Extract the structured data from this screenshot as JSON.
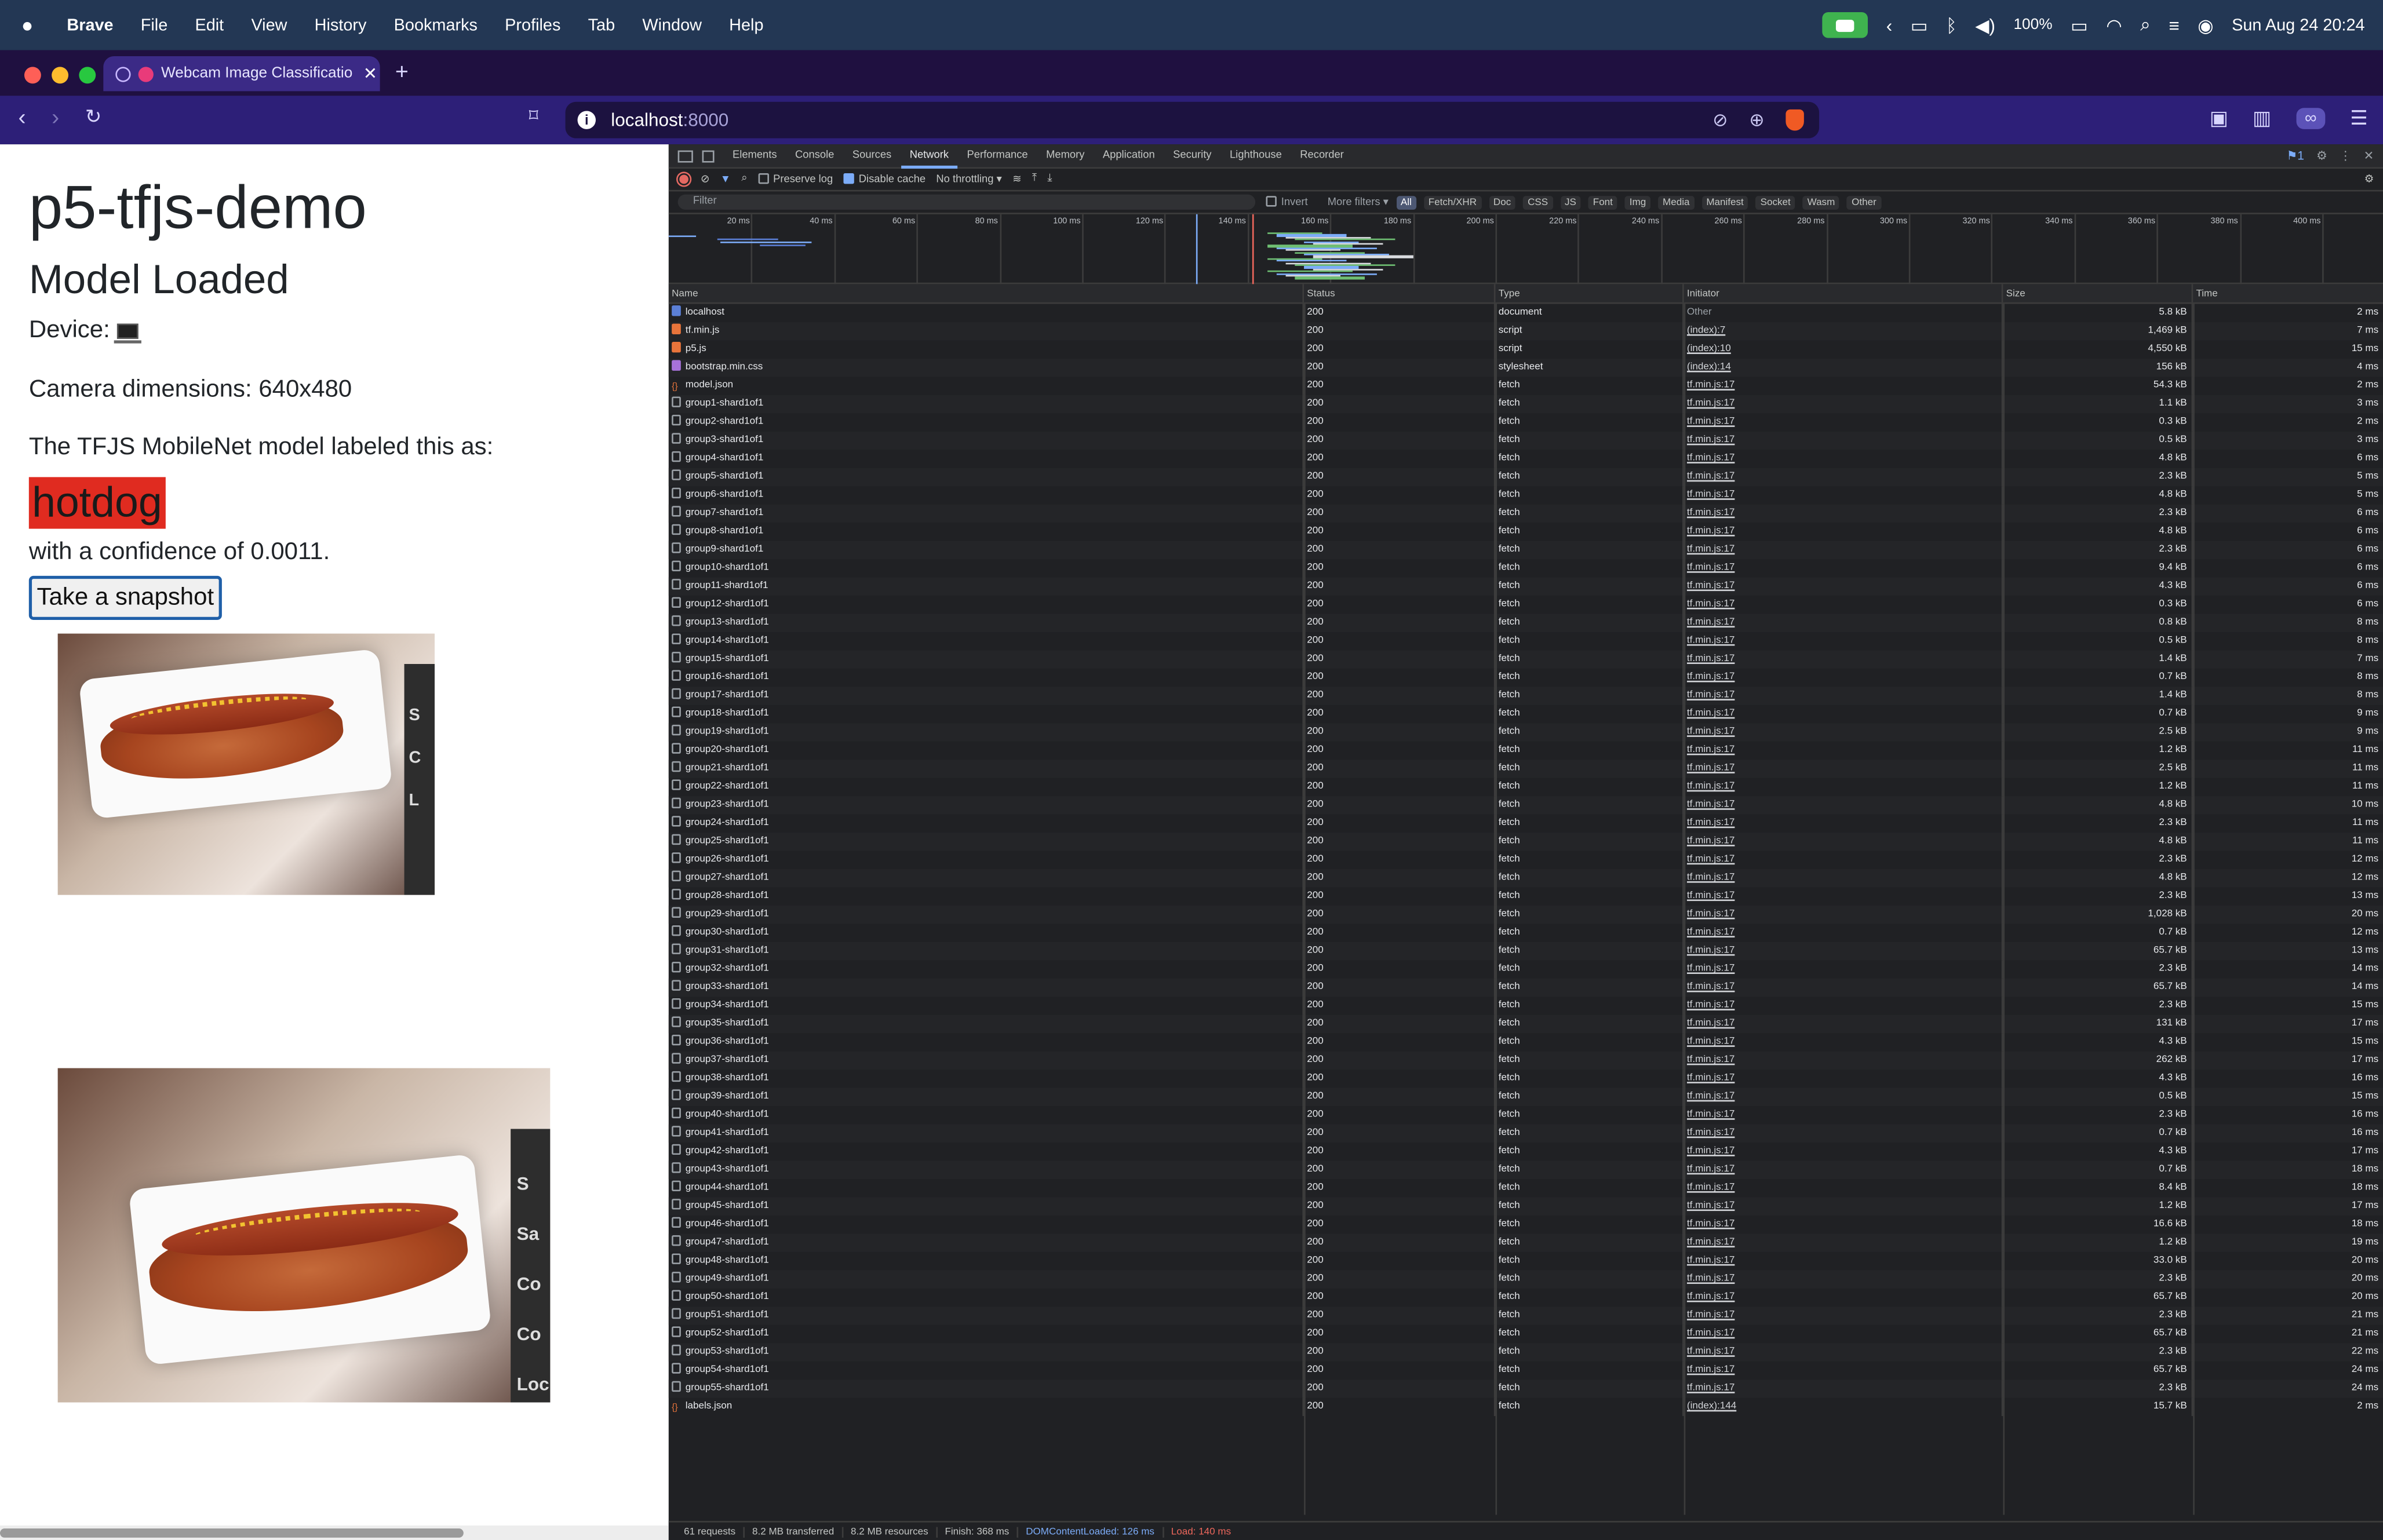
{
  "menubar": {
    "app": "Brave",
    "items": [
      "File",
      "Edit",
      "View",
      "History",
      "Bookmarks",
      "Profiles",
      "Tab",
      "Window",
      "Help"
    ],
    "battery": "100%",
    "datetime": "Sun Aug 24  20:24"
  },
  "browser": {
    "tab_title": "Webcam Image Classificatio",
    "url_host": "localhost",
    "url_port": ":8000"
  },
  "page": {
    "title": "p5-tfjs-demo",
    "status": "Model Loaded",
    "device_label": "Device:",
    "camera": "Camera dimensions: 640x480",
    "labeled_text": "The TFJS MobileNet model labeled this as:",
    "label": "hotdog",
    "confidence": "with a confidence of 0.0011.",
    "snapshot_button": "Take a snapshot",
    "frame1_side": [
      "S",
      "C",
      "L"
    ],
    "frame2_side": [
      "S",
      "Sa",
      "Co",
      "Co",
      "Loc"
    ]
  },
  "devtools": {
    "tabs": [
      "Elements",
      "Console",
      "Sources",
      "Network",
      "Performance",
      "Memory",
      "Application",
      "Security",
      "Lighthouse",
      "Recorder"
    ],
    "active_tab": "Network",
    "issues_badge": "1",
    "preserve_log": "Preserve log",
    "disable_cache": "Disable cache",
    "throttling": "No throttling",
    "filter_placeholder": "Filter",
    "invert": "Invert",
    "more_filters": "More filters",
    "type_filters": [
      "All",
      "Fetch/XHR",
      "Doc",
      "CSS",
      "JS",
      "Font",
      "Img",
      "Media",
      "Manifest",
      "Socket",
      "Wasm",
      "Other"
    ],
    "timeline_ticks": [
      "20 ms",
      "40 ms",
      "60 ms",
      "80 ms",
      "100 ms",
      "120 ms",
      "140 ms",
      "160 ms",
      "180 ms",
      "200 ms",
      "220 ms",
      "240 ms",
      "260 ms",
      "280 ms",
      "300 ms",
      "320 ms",
      "340 ms",
      "360 ms",
      "380 ms",
      "400 ms"
    ],
    "columns": [
      "Name",
      "Status",
      "Type",
      "Initiator",
      "Size",
      "Time"
    ],
    "requests": [
      {
        "name": "localhost",
        "status": "200",
        "type": "document",
        "initiator": "Other",
        "size": "5.8 kB",
        "time": "2 ms",
        "icon": "doc"
      },
      {
        "name": "tf.min.js",
        "status": "200",
        "type": "script",
        "initiator": "(index):7",
        "size": "1,469 kB",
        "time": "7 ms",
        "icon": "js"
      },
      {
        "name": "p5.js",
        "status": "200",
        "type": "script",
        "initiator": "(index):10",
        "size": "4,550 kB",
        "time": "15 ms",
        "icon": "js"
      },
      {
        "name": "bootstrap.min.css",
        "status": "200",
        "type": "stylesheet",
        "initiator": "(index):14",
        "size": "156 kB",
        "time": "4 ms",
        "icon": "css"
      },
      {
        "name": "model.json",
        "status": "200",
        "type": "fetch",
        "initiator": "tf.min.js:17",
        "size": "54.3 kB",
        "time": "2 ms",
        "icon": "json"
      },
      {
        "name": "group1-shard1of1",
        "status": "200",
        "type": "fetch",
        "initiator": "tf.min.js:17",
        "size": "1.1 kB",
        "time": "3 ms",
        "icon": "file"
      },
      {
        "name": "group2-shard1of1",
        "status": "200",
        "type": "fetch",
        "initiator": "tf.min.js:17",
        "size": "0.3 kB",
        "time": "2 ms",
        "icon": "file"
      },
      {
        "name": "group3-shard1of1",
        "status": "200",
        "type": "fetch",
        "initiator": "tf.min.js:17",
        "size": "0.5 kB",
        "time": "3 ms",
        "icon": "file"
      },
      {
        "name": "group4-shard1of1",
        "status": "200",
        "type": "fetch",
        "initiator": "tf.min.js:17",
        "size": "4.8 kB",
        "time": "6 ms",
        "icon": "file"
      },
      {
        "name": "group5-shard1of1",
        "status": "200",
        "type": "fetch",
        "initiator": "tf.min.js:17",
        "size": "2.3 kB",
        "time": "5 ms",
        "icon": "file"
      },
      {
        "name": "group6-shard1of1",
        "status": "200",
        "type": "fetch",
        "initiator": "tf.min.js:17",
        "size": "4.8 kB",
        "time": "5 ms",
        "icon": "file"
      },
      {
        "name": "group7-shard1of1",
        "status": "200",
        "type": "fetch",
        "initiator": "tf.min.js:17",
        "size": "2.3 kB",
        "time": "6 ms",
        "icon": "file"
      },
      {
        "name": "group8-shard1of1",
        "status": "200",
        "type": "fetch",
        "initiator": "tf.min.js:17",
        "size": "4.8 kB",
        "time": "6 ms",
        "icon": "file"
      },
      {
        "name": "group9-shard1of1",
        "status": "200",
        "type": "fetch",
        "initiator": "tf.min.js:17",
        "size": "2.3 kB",
        "time": "6 ms",
        "icon": "file"
      },
      {
        "name": "group10-shard1of1",
        "status": "200",
        "type": "fetch",
        "initiator": "tf.min.js:17",
        "size": "9.4 kB",
        "time": "6 ms",
        "icon": "file"
      },
      {
        "name": "group11-shard1of1",
        "status": "200",
        "type": "fetch",
        "initiator": "tf.min.js:17",
        "size": "4.3 kB",
        "time": "6 ms",
        "icon": "file"
      },
      {
        "name": "group12-shard1of1",
        "status": "200",
        "type": "fetch",
        "initiator": "tf.min.js:17",
        "size": "0.3 kB",
        "time": "6 ms",
        "icon": "file"
      },
      {
        "name": "group13-shard1of1",
        "status": "200",
        "type": "fetch",
        "initiator": "tf.min.js:17",
        "size": "0.8 kB",
        "time": "8 ms",
        "icon": "file"
      },
      {
        "name": "group14-shard1of1",
        "status": "200",
        "type": "fetch",
        "initiator": "tf.min.js:17",
        "size": "0.5 kB",
        "time": "8 ms",
        "icon": "file"
      },
      {
        "name": "group15-shard1of1",
        "status": "200",
        "type": "fetch",
        "initiator": "tf.min.js:17",
        "size": "1.4 kB",
        "time": "7 ms",
        "icon": "file"
      },
      {
        "name": "group16-shard1of1",
        "status": "200",
        "type": "fetch",
        "initiator": "tf.min.js:17",
        "size": "0.7 kB",
        "time": "8 ms",
        "icon": "file"
      },
      {
        "name": "group17-shard1of1",
        "status": "200",
        "type": "fetch",
        "initiator": "tf.min.js:17",
        "size": "1.4 kB",
        "time": "8 ms",
        "icon": "file"
      },
      {
        "name": "group18-shard1of1",
        "status": "200",
        "type": "fetch",
        "initiator": "tf.min.js:17",
        "size": "0.7 kB",
        "time": "9 ms",
        "icon": "file"
      },
      {
        "name": "group19-shard1of1",
        "status": "200",
        "type": "fetch",
        "initiator": "tf.min.js:17",
        "size": "2.5 kB",
        "time": "9 ms",
        "icon": "file"
      },
      {
        "name": "group20-shard1of1",
        "status": "200",
        "type": "fetch",
        "initiator": "tf.min.js:17",
        "size": "1.2 kB",
        "time": "11 ms",
        "icon": "file"
      },
      {
        "name": "group21-shard1of1",
        "status": "200",
        "type": "fetch",
        "initiator": "tf.min.js:17",
        "size": "2.5 kB",
        "time": "11 ms",
        "icon": "file"
      },
      {
        "name": "group22-shard1of1",
        "status": "200",
        "type": "fetch",
        "initiator": "tf.min.js:17",
        "size": "1.2 kB",
        "time": "11 ms",
        "icon": "file"
      },
      {
        "name": "group23-shard1of1",
        "status": "200",
        "type": "fetch",
        "initiator": "tf.min.js:17",
        "size": "4.8 kB",
        "time": "10 ms",
        "icon": "file"
      },
      {
        "name": "group24-shard1of1",
        "status": "200",
        "type": "fetch",
        "initiator": "tf.min.js:17",
        "size": "2.3 kB",
        "time": "11 ms",
        "icon": "file"
      },
      {
        "name": "group25-shard1of1",
        "status": "200",
        "type": "fetch",
        "initiator": "tf.min.js:17",
        "size": "4.8 kB",
        "time": "11 ms",
        "icon": "file"
      },
      {
        "name": "group26-shard1of1",
        "status": "200",
        "type": "fetch",
        "initiator": "tf.min.js:17",
        "size": "2.3 kB",
        "time": "12 ms",
        "icon": "file"
      },
      {
        "name": "group27-shard1of1",
        "status": "200",
        "type": "fetch",
        "initiator": "tf.min.js:17",
        "size": "4.8 kB",
        "time": "12 ms",
        "icon": "file"
      },
      {
        "name": "group28-shard1of1",
        "status": "200",
        "type": "fetch",
        "initiator": "tf.min.js:17",
        "size": "2.3 kB",
        "time": "13 ms",
        "icon": "file"
      },
      {
        "name": "group29-shard1of1",
        "status": "200",
        "type": "fetch",
        "initiator": "tf.min.js:17",
        "size": "1,028 kB",
        "time": "20 ms",
        "icon": "file"
      },
      {
        "name": "group30-shard1of1",
        "status": "200",
        "type": "fetch",
        "initiator": "tf.min.js:17",
        "size": "0.7 kB",
        "time": "12 ms",
        "icon": "file"
      },
      {
        "name": "group31-shard1of1",
        "status": "200",
        "type": "fetch",
        "initiator": "tf.min.js:17",
        "size": "65.7 kB",
        "time": "13 ms",
        "icon": "file"
      },
      {
        "name": "group32-shard1of1",
        "status": "200",
        "type": "fetch",
        "initiator": "tf.min.js:17",
        "size": "2.3 kB",
        "time": "14 ms",
        "icon": "file"
      },
      {
        "name": "group33-shard1of1",
        "status": "200",
        "type": "fetch",
        "initiator": "tf.min.js:17",
        "size": "65.7 kB",
        "time": "14 ms",
        "icon": "file"
      },
      {
        "name": "group34-shard1of1",
        "status": "200",
        "type": "fetch",
        "initiator": "tf.min.js:17",
        "size": "2.3 kB",
        "time": "15 ms",
        "icon": "file"
      },
      {
        "name": "group35-shard1of1",
        "status": "200",
        "type": "fetch",
        "initiator": "tf.min.js:17",
        "size": "131 kB",
        "time": "17 ms",
        "icon": "file"
      },
      {
        "name": "group36-shard1of1",
        "status": "200",
        "type": "fetch",
        "initiator": "tf.min.js:17",
        "size": "4.3 kB",
        "time": "15 ms",
        "icon": "file"
      },
      {
        "name": "group37-shard1of1",
        "status": "200",
        "type": "fetch",
        "initiator": "tf.min.js:17",
        "size": "262 kB",
        "time": "17 ms",
        "icon": "file"
      },
      {
        "name": "group38-shard1of1",
        "status": "200",
        "type": "fetch",
        "initiator": "tf.min.js:17",
        "size": "4.3 kB",
        "time": "16 ms",
        "icon": "file"
      },
      {
        "name": "group39-shard1of1",
        "status": "200",
        "type": "fetch",
        "initiator": "tf.min.js:17",
        "size": "0.5 kB",
        "time": "15 ms",
        "icon": "file"
      },
      {
        "name": "group40-shard1of1",
        "status": "200",
        "type": "fetch",
        "initiator": "tf.min.js:17",
        "size": "2.3 kB",
        "time": "16 ms",
        "icon": "file"
      },
      {
        "name": "group41-shard1of1",
        "status": "200",
        "type": "fetch",
        "initiator": "tf.min.js:17",
        "size": "0.7 kB",
        "time": "16 ms",
        "icon": "file"
      },
      {
        "name": "group42-shard1of1",
        "status": "200",
        "type": "fetch",
        "initiator": "tf.min.js:17",
        "size": "4.3 kB",
        "time": "17 ms",
        "icon": "file"
      },
      {
        "name": "group43-shard1of1",
        "status": "200",
        "type": "fetch",
        "initiator": "tf.min.js:17",
        "size": "0.7 kB",
        "time": "18 ms",
        "icon": "file"
      },
      {
        "name": "group44-shard1of1",
        "status": "200",
        "type": "fetch",
        "initiator": "tf.min.js:17",
        "size": "8.4 kB",
        "time": "18 ms",
        "icon": "file"
      },
      {
        "name": "group45-shard1of1",
        "status": "200",
        "type": "fetch",
        "initiator": "tf.min.js:17",
        "size": "1.2 kB",
        "time": "17 ms",
        "icon": "file"
      },
      {
        "name": "group46-shard1of1",
        "status": "200",
        "type": "fetch",
        "initiator": "tf.min.js:17",
        "size": "16.6 kB",
        "time": "18 ms",
        "icon": "file"
      },
      {
        "name": "group47-shard1of1",
        "status": "200",
        "type": "fetch",
        "initiator": "tf.min.js:17",
        "size": "1.2 kB",
        "time": "19 ms",
        "icon": "file"
      },
      {
        "name": "group48-shard1of1",
        "status": "200",
        "type": "fetch",
        "initiator": "tf.min.js:17",
        "size": "33.0 kB",
        "time": "20 ms",
        "icon": "file"
      },
      {
        "name": "group49-shard1of1",
        "status": "200",
        "type": "fetch",
        "initiator": "tf.min.js:17",
        "size": "2.3 kB",
        "time": "20 ms",
        "icon": "file"
      },
      {
        "name": "group50-shard1of1",
        "status": "200",
        "type": "fetch",
        "initiator": "tf.min.js:17",
        "size": "65.7 kB",
        "time": "20 ms",
        "icon": "file"
      },
      {
        "name": "group51-shard1of1",
        "status": "200",
        "type": "fetch",
        "initiator": "tf.min.js:17",
        "size": "2.3 kB",
        "time": "21 ms",
        "icon": "file"
      },
      {
        "name": "group52-shard1of1",
        "status": "200",
        "type": "fetch",
        "initiator": "tf.min.js:17",
        "size": "65.7 kB",
        "time": "21 ms",
        "icon": "file"
      },
      {
        "name": "group53-shard1of1",
        "status": "200",
        "type": "fetch",
        "initiator": "tf.min.js:17",
        "size": "2.3 kB",
        "time": "22 ms",
        "icon": "file"
      },
      {
        "name": "group54-shard1of1",
        "status": "200",
        "type": "fetch",
        "initiator": "tf.min.js:17",
        "size": "65.7 kB",
        "time": "24 ms",
        "icon": "file"
      },
      {
        "name": "group55-shard1of1",
        "status": "200",
        "type": "fetch",
        "initiator": "tf.min.js:17",
        "size": "2.3 kB",
        "time": "24 ms",
        "icon": "file"
      },
      {
        "name": "labels.json",
        "status": "200",
        "type": "fetch",
        "initiator": "(index):144",
        "size": "15.7 kB",
        "time": "2 ms",
        "icon": "json"
      }
    ],
    "summary": {
      "requests": "61 requests",
      "transferred": "8.2 MB transferred",
      "resources": "8.2 MB resources",
      "finish": "Finish: 368 ms",
      "dcl": "DOMContentLoaded: 126 ms",
      "load": "Load: 140 ms"
    }
  },
  "colors": {
    "menubar_bg": "#233754",
    "tabbar_bg": "#1f1040",
    "navbar_bg": "#2d1f78",
    "label_red": "#e02b20",
    "devtools_bg": "#202124",
    "accent_blue": "#7cacf8"
  }
}
